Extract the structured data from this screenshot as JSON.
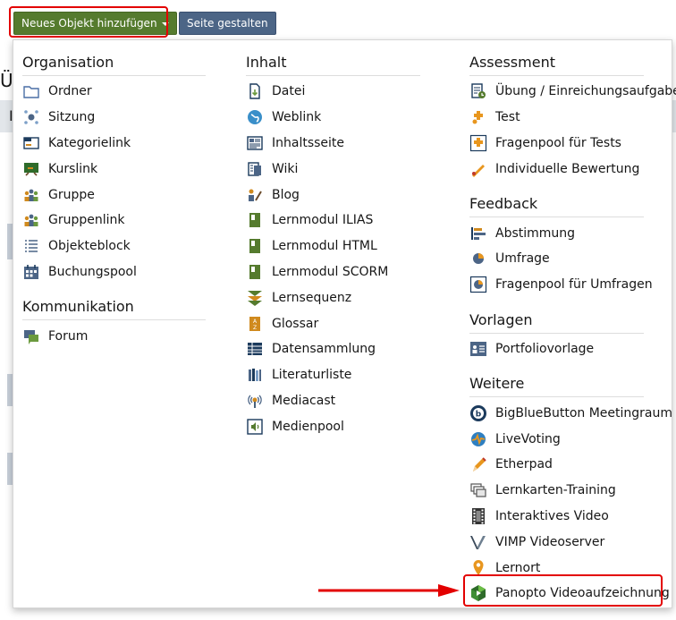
{
  "toolbar": {
    "new_object_label": "Neues Objekt hinzufügen",
    "design_page_label": "Seite gestalten"
  },
  "background": {
    "heading_fragment": "Ü",
    "line_fragment": "I"
  },
  "columns": [
    {
      "groups": [
        {
          "title": "Organisation",
          "items": [
            {
              "label": "Ordner",
              "icon": "folder-icon"
            },
            {
              "label": "Sitzung",
              "icon": "session-icon"
            },
            {
              "label": "Kategorielink",
              "icon": "category-link-icon"
            },
            {
              "label": "Kurslink",
              "icon": "course-link-icon"
            },
            {
              "label": "Gruppe",
              "icon": "group-icon"
            },
            {
              "label": "Gruppenlink",
              "icon": "group-link-icon"
            },
            {
              "label": "Objekteblock",
              "icon": "item-group-icon"
            },
            {
              "label": "Buchungspool",
              "icon": "booking-pool-icon"
            }
          ]
        },
        {
          "title": "Kommunikation",
          "items": [
            {
              "label": "Forum",
              "icon": "forum-icon"
            }
          ]
        }
      ]
    },
    {
      "groups": [
        {
          "title": "Inhalt",
          "items": [
            {
              "label": "Datei",
              "icon": "file-icon"
            },
            {
              "label": "Weblink",
              "icon": "weblink-icon"
            },
            {
              "label": "Inhaltsseite",
              "icon": "content-page-icon"
            },
            {
              "label": "Wiki",
              "icon": "wiki-icon"
            },
            {
              "label": "Blog",
              "icon": "blog-icon"
            },
            {
              "label": "Lernmodul ILIAS",
              "icon": "learning-module-icon"
            },
            {
              "label": "Lernmodul HTML",
              "icon": "learning-module-html-icon"
            },
            {
              "label": "Lernmodul SCORM",
              "icon": "learning-module-scorm-icon"
            },
            {
              "label": "Lernsequenz",
              "icon": "learning-sequence-icon"
            },
            {
              "label": "Glossar",
              "icon": "glossary-icon"
            },
            {
              "label": "Datensammlung",
              "icon": "data-collection-icon"
            },
            {
              "label": "Literaturliste",
              "icon": "bibliography-icon"
            },
            {
              "label": "Mediacast",
              "icon": "mediacast-icon"
            },
            {
              "label": "Medienpool",
              "icon": "media-pool-icon"
            }
          ]
        }
      ]
    },
    {
      "groups": [
        {
          "title": "Assessment",
          "items": [
            {
              "label": "Übung / Einreichungsaufgabe",
              "icon": "exercise-icon"
            },
            {
              "label": "Test",
              "icon": "test-icon"
            },
            {
              "label": "Fragenpool für Tests",
              "icon": "question-pool-icon"
            },
            {
              "label": "Individuelle Bewertung",
              "icon": "individual-assessment-icon"
            }
          ]
        },
        {
          "title": "Feedback",
          "items": [
            {
              "label": "Abstimmung",
              "icon": "poll-icon"
            },
            {
              "label": "Umfrage",
              "icon": "survey-icon"
            },
            {
              "label": "Fragenpool für Umfragen",
              "icon": "survey-pool-icon"
            }
          ]
        },
        {
          "title": "Vorlagen",
          "items": [
            {
              "label": "Portfoliovorlage",
              "icon": "portfolio-template-icon"
            }
          ]
        },
        {
          "title": "Weitere",
          "items": [
            {
              "label": "BigBlueButton Meetingraum",
              "icon": "bigbluebutton-icon"
            },
            {
              "label": "LiveVoting",
              "icon": "livevoting-icon"
            },
            {
              "label": "Etherpad",
              "icon": "etherpad-icon"
            },
            {
              "label": "Lernkarten-Training",
              "icon": "flashcards-icon"
            },
            {
              "label": "Interaktives Video",
              "icon": "interactive-video-icon"
            },
            {
              "label": "VIMP Videoserver",
              "icon": "vimp-icon"
            },
            {
              "label": "Lernort",
              "icon": "location-pin-icon"
            },
            {
              "label": "Panopto Videoaufzeichnung",
              "icon": "panopto-icon",
              "highlighted": true
            }
          ]
        }
      ]
    }
  ],
  "colors": {
    "primary_button": "#557b2e",
    "secondary_button": "#4c6586",
    "highlight": "#e30000"
  }
}
